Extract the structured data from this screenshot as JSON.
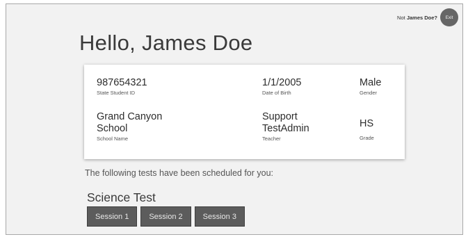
{
  "header": {
    "greeting": "Hello, James Doe",
    "not_user_prefix": "Not ",
    "not_user_name": "James Doe?",
    "exit_label": "Exit"
  },
  "student": {
    "id_value": "987654321",
    "id_label": "State Student ID",
    "dob_value": "1/1/2005",
    "dob_label": "Date of Birth",
    "gender_value": "Male",
    "gender_label": "Gender",
    "school_line1": "Grand Canyon",
    "school_line2": "School",
    "school_label": "School Name",
    "teacher_line1": "Support",
    "teacher_line2": "TestAdmin",
    "teacher_label": "Teacher",
    "grade_value": "HS",
    "grade_label": "Grade"
  },
  "schedule": {
    "intro": "The following tests have been scheduled for you:",
    "test_name": "Science Test",
    "sessions": [
      "Session 1",
      "Session 2",
      "Session 3"
    ]
  }
}
